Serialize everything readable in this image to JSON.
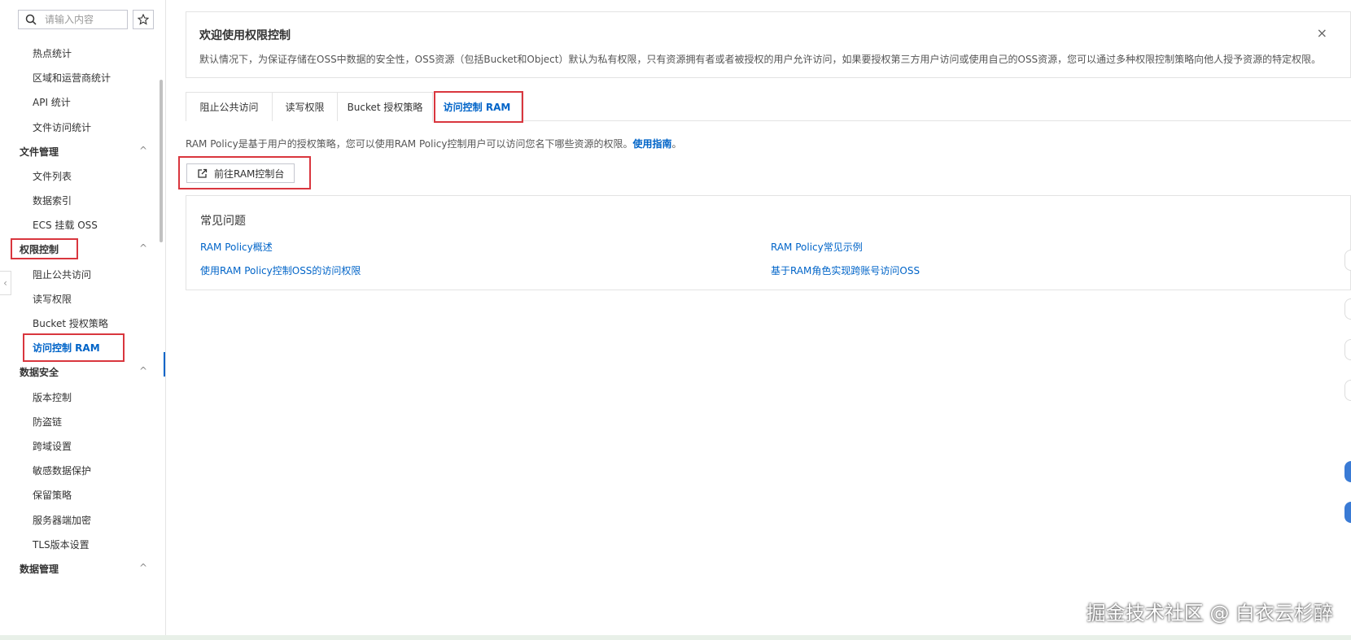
{
  "sidebar": {
    "search_placeholder": "请输入内容",
    "items_top": [
      "热点统计",
      "区域和运营商统计",
      "API 统计",
      "文件访问统计"
    ],
    "group_file": "文件管理",
    "items_file": [
      "文件列表",
      "数据索引",
      "ECS 挂载 OSS"
    ],
    "group_perm": "权限控制",
    "items_perm": [
      "阻止公共访问",
      "读写权限",
      "Bucket 授权策略",
      "访问控制 RAM"
    ],
    "group_security": "数据安全",
    "items_security": [
      "版本控制",
      "防盗链",
      "跨域设置",
      "敏感数据保护",
      "保留策略",
      "服务器端加密",
      "TLS版本设置"
    ],
    "group_data": "数据管理",
    "chevron": "^"
  },
  "notice": {
    "title": "欢迎使用权限控制",
    "text": "默认情况下，为保证存储在OSS中数据的安全性，OSS资源（包括Bucket和Object）默认为私有权限，只有资源拥有者或者被授权的用户允许访问，如果要授权第三方用户访问或使用自己的OSS资源，您可以通过多种权限控制策略向他人授予资源的特定权限。",
    "close": "×"
  },
  "tabs": [
    "阻止公共访问",
    "读写权限",
    "Bucket 授权策略",
    "访问控制 RAM"
  ],
  "desc": {
    "text": "RAM Policy是基于用户的授权策略，您可以使用RAM Policy控制用户可以访问您名下哪些资源的权限。",
    "link": "使用指南",
    "suffix": "。"
  },
  "goto_button": "前往RAM控制台",
  "faq": {
    "title": "常见问题",
    "links": [
      "RAM Policy概述",
      "RAM Policy常见示例",
      "使用RAM Policy控制OSS的访问权限",
      "基于RAM角色实现跨账号访问OSS"
    ]
  },
  "watermark": "掘金技术社区 @ 白衣云杉醉",
  "colors": {
    "accent": "#0064c8",
    "highlight": "#d9363e"
  }
}
